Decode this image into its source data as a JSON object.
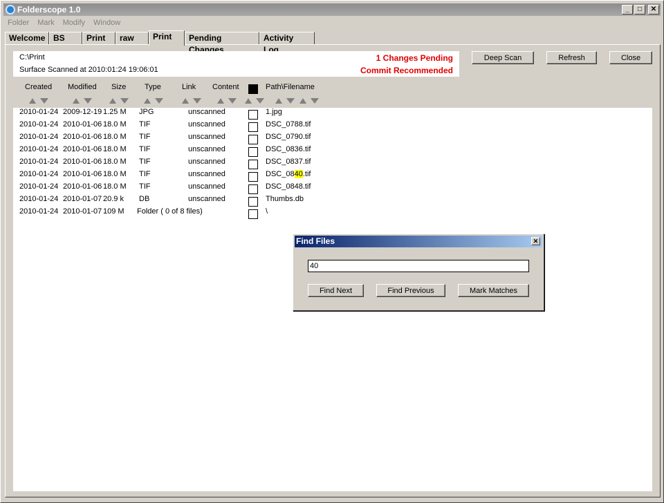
{
  "window": {
    "title": "Folderscope 1.0",
    "controls": [
      "minimize",
      "maximize",
      "close"
    ]
  },
  "menu": [
    "Folder",
    "Mark",
    "Modify",
    "Window"
  ],
  "tabs": [
    {
      "label": "Welcome",
      "active": false
    },
    {
      "label": "BS",
      "active": false
    },
    {
      "label": "Print",
      "active": false
    },
    {
      "label": "raw",
      "active": false
    },
    {
      "label": "Print",
      "active": true
    },
    {
      "label": "Pending Changes",
      "active": false
    },
    {
      "label": "Activity Log",
      "active": false
    }
  ],
  "info": {
    "path": "C:\\Print",
    "scanned": "Surface Scanned at 2010:01:24 19:06:01",
    "pending": "1 Changes Pending",
    "commit": "Commit Recommended",
    "alert_color": "#e00000"
  },
  "buttons": {
    "deep_scan": "Deep Scan",
    "refresh": "Refresh",
    "close": "Close"
  },
  "columns": [
    "Created",
    "Modified",
    "Size",
    "Type",
    "Link",
    "Content",
    "Path\\Filename"
  ],
  "rows": [
    {
      "created": "2010-01-24",
      "modified": "2009-12-19",
      "size": "1.25 M",
      "type": "JPG",
      "link": "unscanned",
      "pre": "1.jpg",
      "hl": "",
      "post": ""
    },
    {
      "created": "2010-01-24",
      "modified": "2010-01-06",
      "size": "18.0 M",
      "type": "TIF",
      "link": "unscanned",
      "pre": "DSC_0788.tif",
      "hl": "",
      "post": ""
    },
    {
      "created": "2010-01-24",
      "modified": "2010-01-06",
      "size": "18.0 M",
      "type": "TIF",
      "link": "unscanned",
      "pre": "DSC_0790.tif",
      "hl": "",
      "post": ""
    },
    {
      "created": "2010-01-24",
      "modified": "2010-01-06",
      "size": "18.0 M",
      "type": "TIF",
      "link": "unscanned",
      "pre": "DSC_0836.tif",
      "hl": "",
      "post": ""
    },
    {
      "created": "2010-01-24",
      "modified": "2010-01-06",
      "size": "18.0 M",
      "type": "TIF",
      "link": "unscanned",
      "pre": "DSC_0837.tif",
      "hl": "",
      "post": ""
    },
    {
      "created": "2010-01-24",
      "modified": "2010-01-06",
      "size": "18.0 M",
      "type": "TIF",
      "link": "unscanned",
      "pre": "DSC_08",
      "hl": "40",
      "post": ".tif"
    },
    {
      "created": "2010-01-24",
      "modified": "2010-01-06",
      "size": "18.0 M",
      "type": "TIF",
      "link": "unscanned",
      "pre": "DSC_0848.tif",
      "hl": "",
      "post": ""
    },
    {
      "created": "2010-01-24",
      "modified": "2010-01-07",
      "size": "20.9 k",
      "type": "DB",
      "link": "unscanned",
      "pre": "Thumbs.db",
      "hl": "",
      "post": ""
    },
    {
      "created": "2010-01-24",
      "modified": "2010-01-07",
      "size": "109 M",
      "type": "Folder ( 0 of 8 files)",
      "link": "",
      "pre": "\\",
      "hl": "",
      "post": ""
    }
  ],
  "find_dialog": {
    "title": "Find Files",
    "query": "40",
    "find_next": "Find Next",
    "find_previous": "Find Previous",
    "mark_matches": "Mark Matches"
  }
}
